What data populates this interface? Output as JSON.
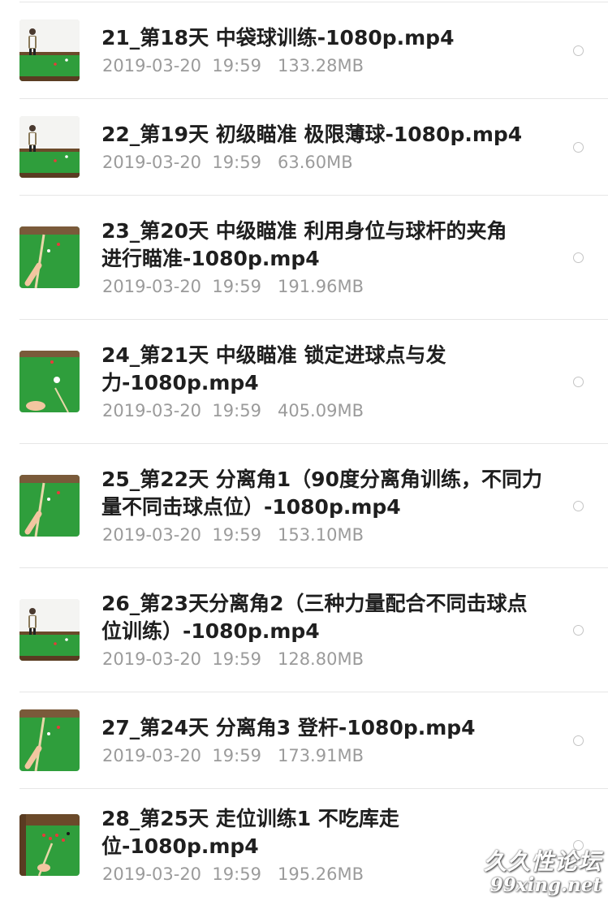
{
  "files": [
    {
      "title_lines": [
        "21_第18天 中袋球训练-1080p.mp4"
      ],
      "date": "2019-03-20",
      "time": "19:59",
      "size": "133.28MB",
      "thumbnail": "snooker-player-standing-icon"
    },
    {
      "title_lines": [
        "22_第19天 初级瞄准 极限薄球-1080p.mp4"
      ],
      "date": "2019-03-20",
      "time": "19:59",
      "size": "63.60MB",
      "thumbnail": "snooker-player-standing-icon"
    },
    {
      "title_lines": [
        "23_第20天 中级瞄准  利用身位与球杆的夹角",
        "进行瞄准-1080p.mp4"
      ],
      "date": "2019-03-20",
      "time": "19:59",
      "size": "191.96MB",
      "thumbnail": "snooker-cue-aiming-icon"
    },
    {
      "title_lines": [
        "24_第21天 中级瞄准  锁定进球点与发",
        "力-1080p.mp4"
      ],
      "date": "2019-03-20",
      "time": "19:59",
      "size": "405.09MB",
      "thumbnail": "snooker-hand-bridge-icon"
    },
    {
      "title_lines": [
        "25_第22天 分离角1（90度分离角训练，不同力",
        "量不同击球点位）-1080p.mp4"
      ],
      "date": "2019-03-20",
      "time": "19:59",
      "size": "153.10MB",
      "thumbnail": "snooker-cue-aiming-icon"
    },
    {
      "title_lines": [
        "26_第23天分离角2（三种力量配合不同击球点",
        "位训练）-1080p.mp4"
      ],
      "date": "2019-03-20",
      "time": "19:59",
      "size": "128.80MB",
      "thumbnail": "snooker-player-standing-icon"
    },
    {
      "title_lines": [
        "27_第24天 分离角3 登杆-1080p.mp4"
      ],
      "date": "2019-03-20",
      "time": "19:59",
      "size": "173.91MB",
      "thumbnail": "snooker-cue-aiming-icon"
    },
    {
      "title_lines": [
        "28_第25天  走位训练1 不吃库走",
        "位-1080p.mp4"
      ],
      "date": "2019-03-20",
      "time": "19:59",
      "size": "195.26MB",
      "thumbnail": "snooker-table-reds-icon"
    }
  ],
  "watermark": {
    "line1": "久久性论坛",
    "line2": "99xing.net"
  },
  "colors": {
    "title": "#1f1f1f",
    "meta": "#9b9b9b",
    "divider": "#e6e6e6",
    "radio_border": "#c4c4c4",
    "table_green": "#2f9e3c"
  }
}
